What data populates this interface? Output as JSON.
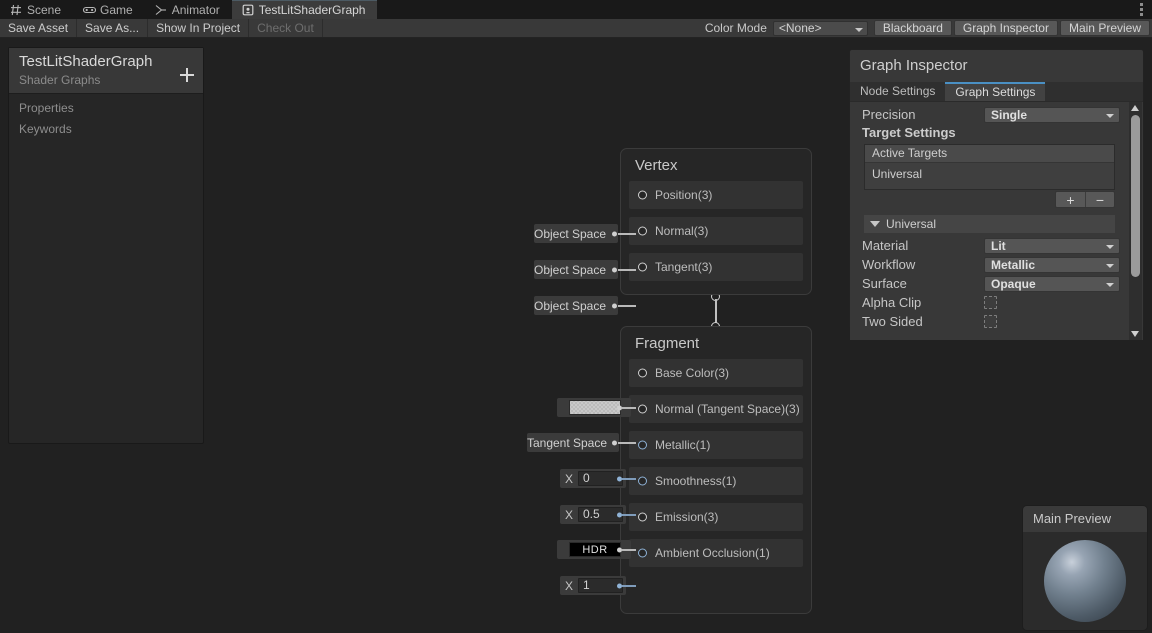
{
  "window": {
    "tabs": [
      {
        "label": "Scene",
        "icon": "grid-icon",
        "active": false
      },
      {
        "label": "Game",
        "icon": "gamepad-icon",
        "active": false
      },
      {
        "label": "Animator",
        "icon": "animator-icon",
        "active": false
      },
      {
        "label": "TestLitShaderGraph",
        "icon": "shadergraph-icon",
        "active": true
      }
    ],
    "menu_icon": "kebab-menu-icon"
  },
  "toolbar": {
    "save_asset": "Save Asset",
    "save_as": "Save As...",
    "show_in_project": "Show In Project",
    "check_out": "Check Out",
    "color_mode_label": "Color Mode",
    "color_mode_value": "<None>",
    "blackboard_button": "Blackboard",
    "graph_inspector_button": "Graph Inspector",
    "main_preview_button": "Main Preview"
  },
  "blackboard": {
    "title": "TestLitShaderGraph",
    "subtitle": "Shader Graphs",
    "add_label": "+",
    "sections": [
      {
        "label": "Properties"
      },
      {
        "label": "Keywords"
      }
    ]
  },
  "graph": {
    "vertex_node": {
      "title": "Vertex",
      "slots": [
        {
          "label": "Position(3)",
          "control": "Object Space",
          "control_type": "space",
          "port_type": "vec3"
        },
        {
          "label": "Normal(3)",
          "control": "Object Space",
          "control_type": "space",
          "port_type": "vec3"
        },
        {
          "label": "Tangent(3)",
          "control": "Object Space",
          "control_type": "space",
          "port_type": "vec3"
        }
      ]
    },
    "fragment_node": {
      "title": "Fragment",
      "slots": [
        {
          "label": "Base Color(3)",
          "control": "",
          "control_type": "color",
          "port_type": "vec3"
        },
        {
          "label": "Normal (Tangent Space)(3)",
          "control": "Tangent Space",
          "control_type": "space",
          "port_type": "vec3"
        },
        {
          "label": "Metallic(1)",
          "control": "0",
          "control_type": "float",
          "axis": "X",
          "port_type": "float"
        },
        {
          "label": "Smoothness(1)",
          "control": "0.5",
          "control_type": "float",
          "axis": "X",
          "port_type": "float"
        },
        {
          "label": "Emission(3)",
          "control": "HDR",
          "control_type": "hdr",
          "port_type": "vec3"
        },
        {
          "label": "Ambient Occlusion(1)",
          "control": "1",
          "control_type": "float",
          "axis": "X",
          "port_type": "float"
        }
      ]
    }
  },
  "inspector": {
    "title": "Graph Inspector",
    "tabs": [
      {
        "label": "Node Settings",
        "active": false
      },
      {
        "label": "Graph Settings",
        "active": true
      }
    ],
    "precision_label": "Precision",
    "precision_value": "Single",
    "target_settings_label": "Target Settings",
    "active_targets_label": "Active Targets",
    "active_targets": [
      "Universal"
    ],
    "add_target_label": "+",
    "remove_target_label": "−",
    "universal_section": "Universal",
    "settings": [
      {
        "label": "Material",
        "value": "Lit",
        "type": "dropdown"
      },
      {
        "label": "Workflow",
        "value": "Metallic",
        "type": "dropdown"
      },
      {
        "label": "Surface",
        "value": "Opaque",
        "type": "dropdown"
      },
      {
        "label": "Alpha Clip",
        "value": "",
        "type": "checkbox"
      },
      {
        "label": "Two Sided",
        "value": "",
        "type": "checkbox"
      }
    ]
  },
  "preview": {
    "title": "Main Preview"
  },
  "colors": {
    "canvas": "#212121",
    "accent": "#4a90c4",
    "float_port": "#8fb2d6"
  }
}
